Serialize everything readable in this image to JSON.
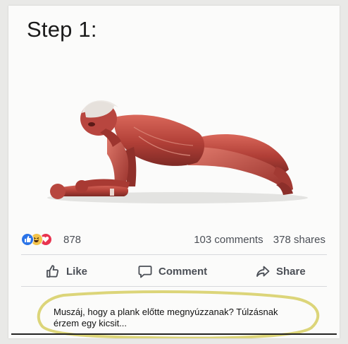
{
  "post": {
    "title": "Step 1:",
    "image_description_icon": "plank-anatomy-illustration"
  },
  "reactions": {
    "icons": [
      "like-icon",
      "haha-icon",
      "love-icon"
    ],
    "count": "878"
  },
  "stats": {
    "comments": "103 comments",
    "shares": "378 shares"
  },
  "actions": {
    "like_label": "Like",
    "comment_label": "Comment",
    "share_label": "Share"
  },
  "comment": {
    "text": "Muszáj, hogy a plank előtte megnyúzzanak? Túlzásnak érzem egy kicsit..."
  },
  "colors": {
    "highlight_circle": "#d8d06a",
    "like_blue": "#2b74e8",
    "love_red": "#e8334f",
    "haha_yellow": "#f3c34a",
    "muscle_red": "#b8463f"
  }
}
